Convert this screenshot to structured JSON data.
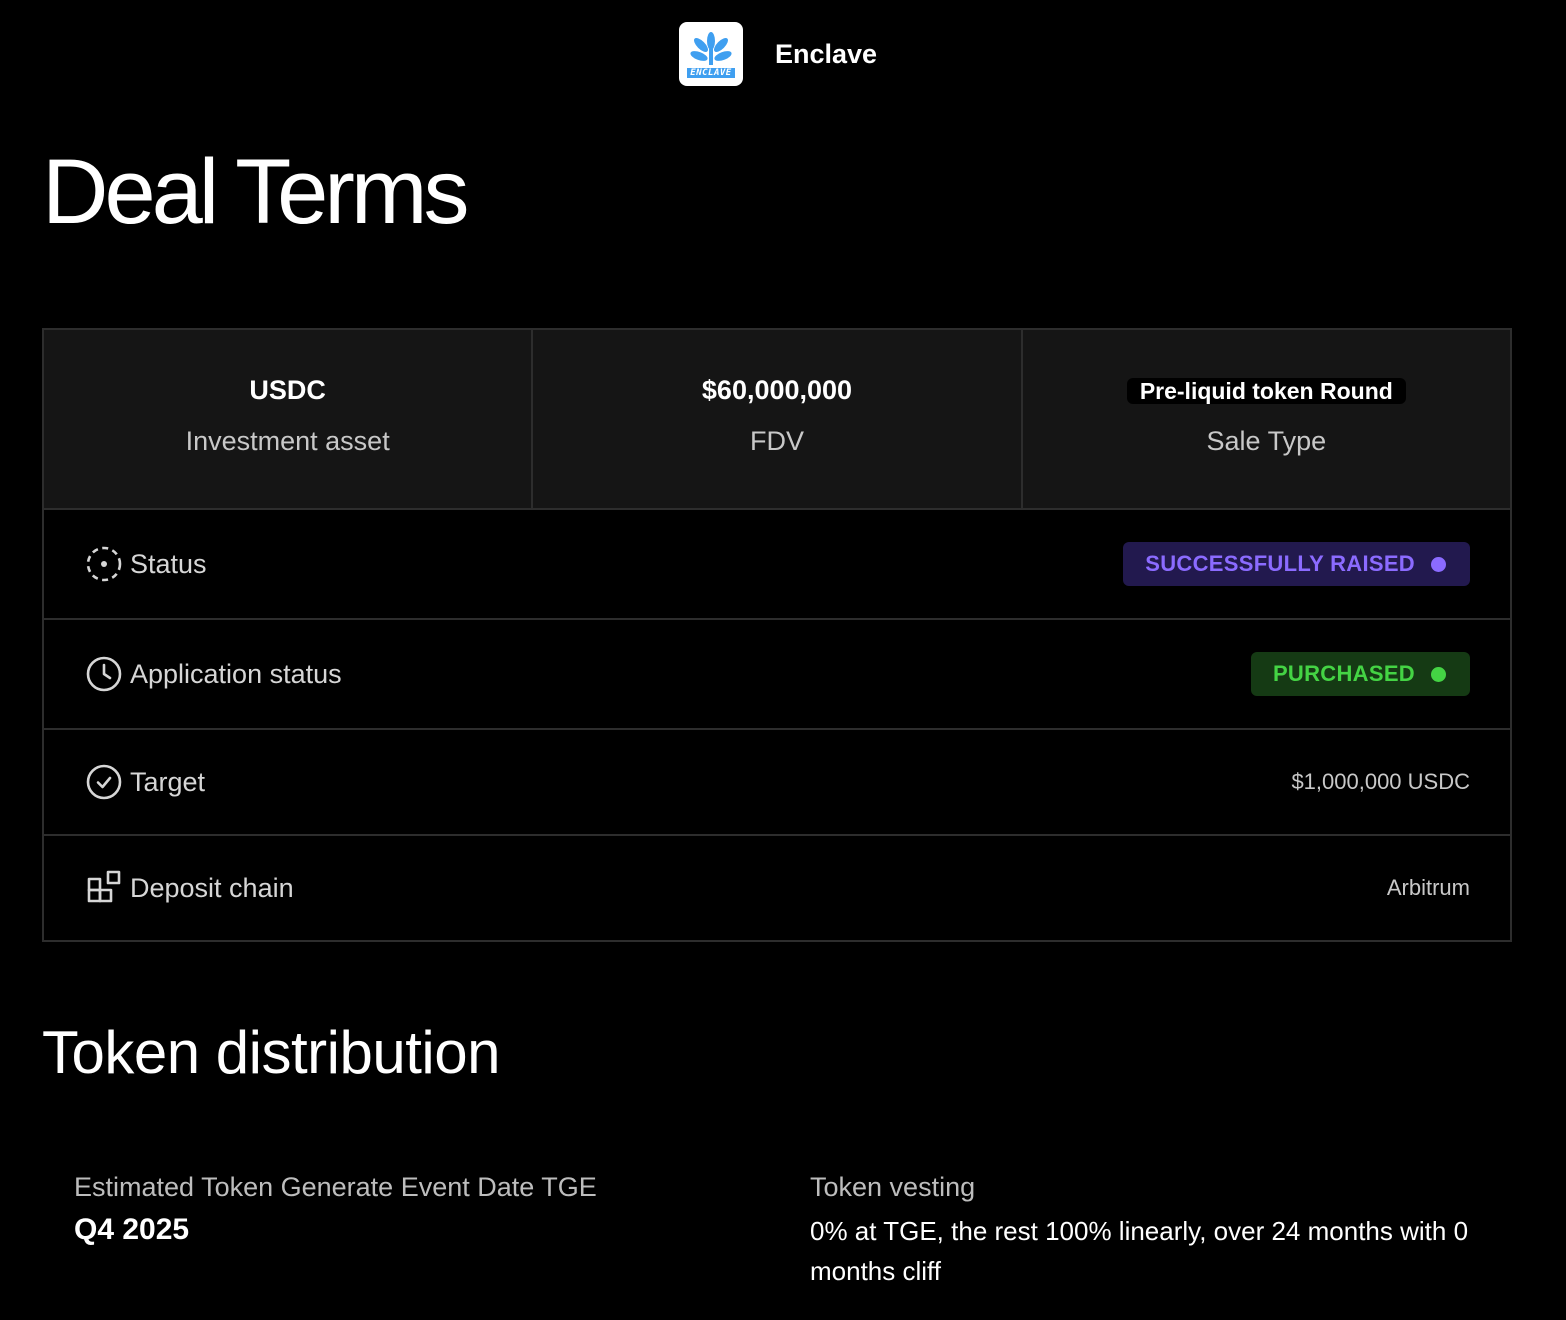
{
  "header": {
    "brand_name": "Enclave",
    "logo_text": "ENCLAVE"
  },
  "page": {
    "title": "Deal Terms"
  },
  "summary": [
    {
      "value": "USDC",
      "label": "Investment asset"
    },
    {
      "value": "$60,000,000",
      "label": "FDV"
    },
    {
      "value": "Pre-liquid token Round",
      "label": "Sale Type"
    }
  ],
  "rows": {
    "status": {
      "label": "Status",
      "badge": "SUCCESSFULLY RAISED",
      "icon": "dashed-circle-icon",
      "color": "#8b6bff"
    },
    "application_status": {
      "label": "Application status",
      "badge": "PURCHASED",
      "icon": "clock-icon",
      "color": "#44d344"
    },
    "target": {
      "label": "Target",
      "value": "$1,000,000 USDC",
      "icon": "check-circle-icon"
    },
    "deposit_chain": {
      "label": "Deposit chain",
      "value": "Arbitrum",
      "icon": "blocks-icon"
    }
  },
  "token_distribution": {
    "title": "Token distribution",
    "tge": {
      "label": "Estimated Token Generate Event Date TGE",
      "value": "Q4 2025"
    },
    "vesting": {
      "label": "Token vesting",
      "value": "0% at TGE, the rest 100% linearly, over 24 months with 0 months cliff"
    }
  }
}
